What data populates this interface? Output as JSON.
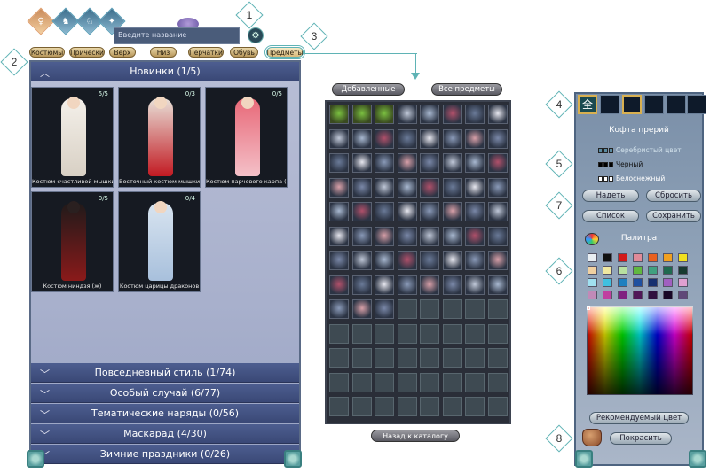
{
  "annotations": [
    "1",
    "2",
    "3",
    "4",
    "5",
    "6",
    "7",
    "8"
  ],
  "search": {
    "placeholder": "Введите название"
  },
  "subtabs": [
    "Костюмы",
    "Прически",
    "Верх",
    "Низ",
    "Перчатки",
    "Обувь",
    "Предметы"
  ],
  "left_panel": {
    "header": "Новинки (1/5)",
    "cards": [
      {
        "count": "5/5",
        "caption": "Костюм счастливой мышки (ж)"
      },
      {
        "count": "0/3",
        "caption": "Восточный костюм мышки (ж)"
      },
      {
        "count": "0/5",
        "caption": "Костюм парчового карпа (ж)"
      },
      {
        "count": "0/5",
        "caption": "Костюм ниндзя (ж)"
      },
      {
        "count": "0/4",
        "caption": "Костюм царицы драконов"
      }
    ],
    "categories": [
      "Повседневный стиль (1/74)",
      "Особый случай (6/77)",
      "Тематические наряды (0/56)",
      "Маскарад (4/30)",
      "Зимние праздники (0/26)"
    ]
  },
  "middle": {
    "added_button": "Добавленные",
    "all_button": "Все предметы",
    "back_button": "Назад к каталогу",
    "filled_items": 67,
    "total_cells": 104
  },
  "right_panel": {
    "item_name": "Кофта прерий",
    "colors": [
      {
        "name": "Серебристый цвет",
        "swatch": [
          "#5a8aa0",
          "#5a8aa0",
          "#5a8aa0"
        ]
      },
      {
        "name": "Черный",
        "swatch": [
          "#000000",
          "#000000",
          "#000000"
        ]
      },
      {
        "name": "Белоснежный",
        "swatch": [
          "#ffffff",
          "#ffffff",
          "#ffffff"
        ]
      }
    ],
    "buttons": {
      "wear": "Надеть",
      "reset": "Сбросить",
      "list": "Список",
      "save": "Сохранить"
    },
    "palette_label": "Палитра",
    "palette": [
      "#e8eef2",
      "#111111",
      "#d21a1a",
      "#e08a98",
      "#e86020",
      "#f0a020",
      "#f0e020",
      "#f0d0a0",
      "#f0e8a0",
      "#b8e0a0",
      "#60b840",
      "#40a080",
      "#206a50",
      "#183a30",
      "#a0e0f0",
      "#40c0e0",
      "#2080c0",
      "#2050a0",
      "#183070",
      "#a060c0",
      "#e0a0d0",
      "#c08ab8",
      "#c040a0",
      "#802080",
      "#501858",
      "#301040",
      "#180828",
      "#604878"
    ],
    "recommended_button": "Рекомендуемый цвет",
    "paint_button": "Покрасить",
    "all_icon": "全"
  }
}
